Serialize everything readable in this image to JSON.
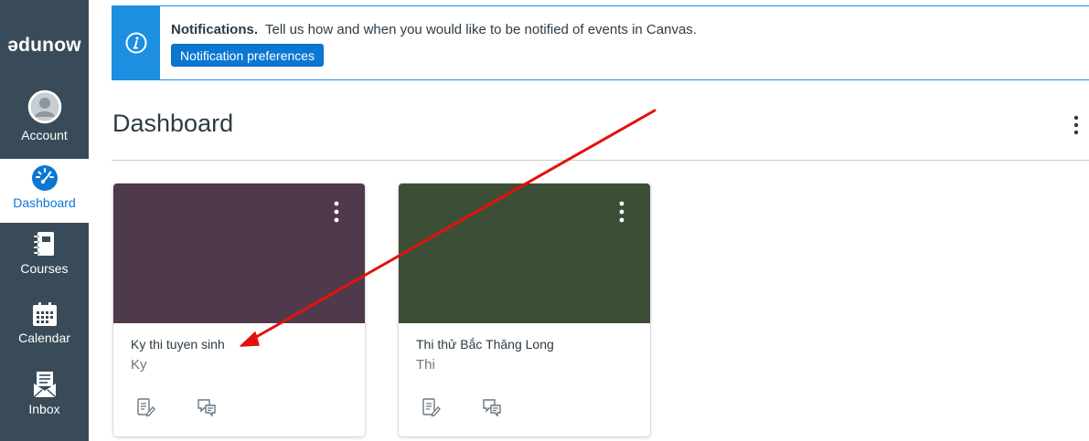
{
  "nav": {
    "logo": "ədunow",
    "items": [
      {
        "id": "account",
        "label": "Account",
        "icon": "avatar-icon"
      },
      {
        "id": "dashboard",
        "label": "Dashboard",
        "icon": "dashboard-icon",
        "active": true
      },
      {
        "id": "courses",
        "label": "Courses",
        "icon": "courses-icon"
      },
      {
        "id": "calendar",
        "label": "Calendar",
        "icon": "calendar-icon"
      },
      {
        "id": "inbox",
        "label": "Inbox",
        "icon": "inbox-icon"
      }
    ]
  },
  "alert": {
    "title": "Notifications.",
    "text": "Tell us how and when you would like to be notified of events in Canvas.",
    "button": "Notification preferences",
    "icon": "info-icon"
  },
  "header": {
    "title": "Dashboard",
    "menu_icon": "kebab-menu-icon"
  },
  "cards": [
    {
      "title": "Ky thi tuyen sinh",
      "subtitle": "Ky",
      "color": "#4f3a4b",
      "actions": [
        "assignments-icon",
        "discussions-icon"
      ]
    },
    {
      "title": "Thi thử Bắc Thăng Long",
      "subtitle": "Thi",
      "color": "#3c4f36",
      "actions": [
        "assignments-icon",
        "discussions-icon"
      ]
    }
  ],
  "colors": {
    "nav_bg": "#394b58",
    "accent": "#0b77d3",
    "alert": "#1d8ee0",
    "annotation": "#e3120b"
  }
}
